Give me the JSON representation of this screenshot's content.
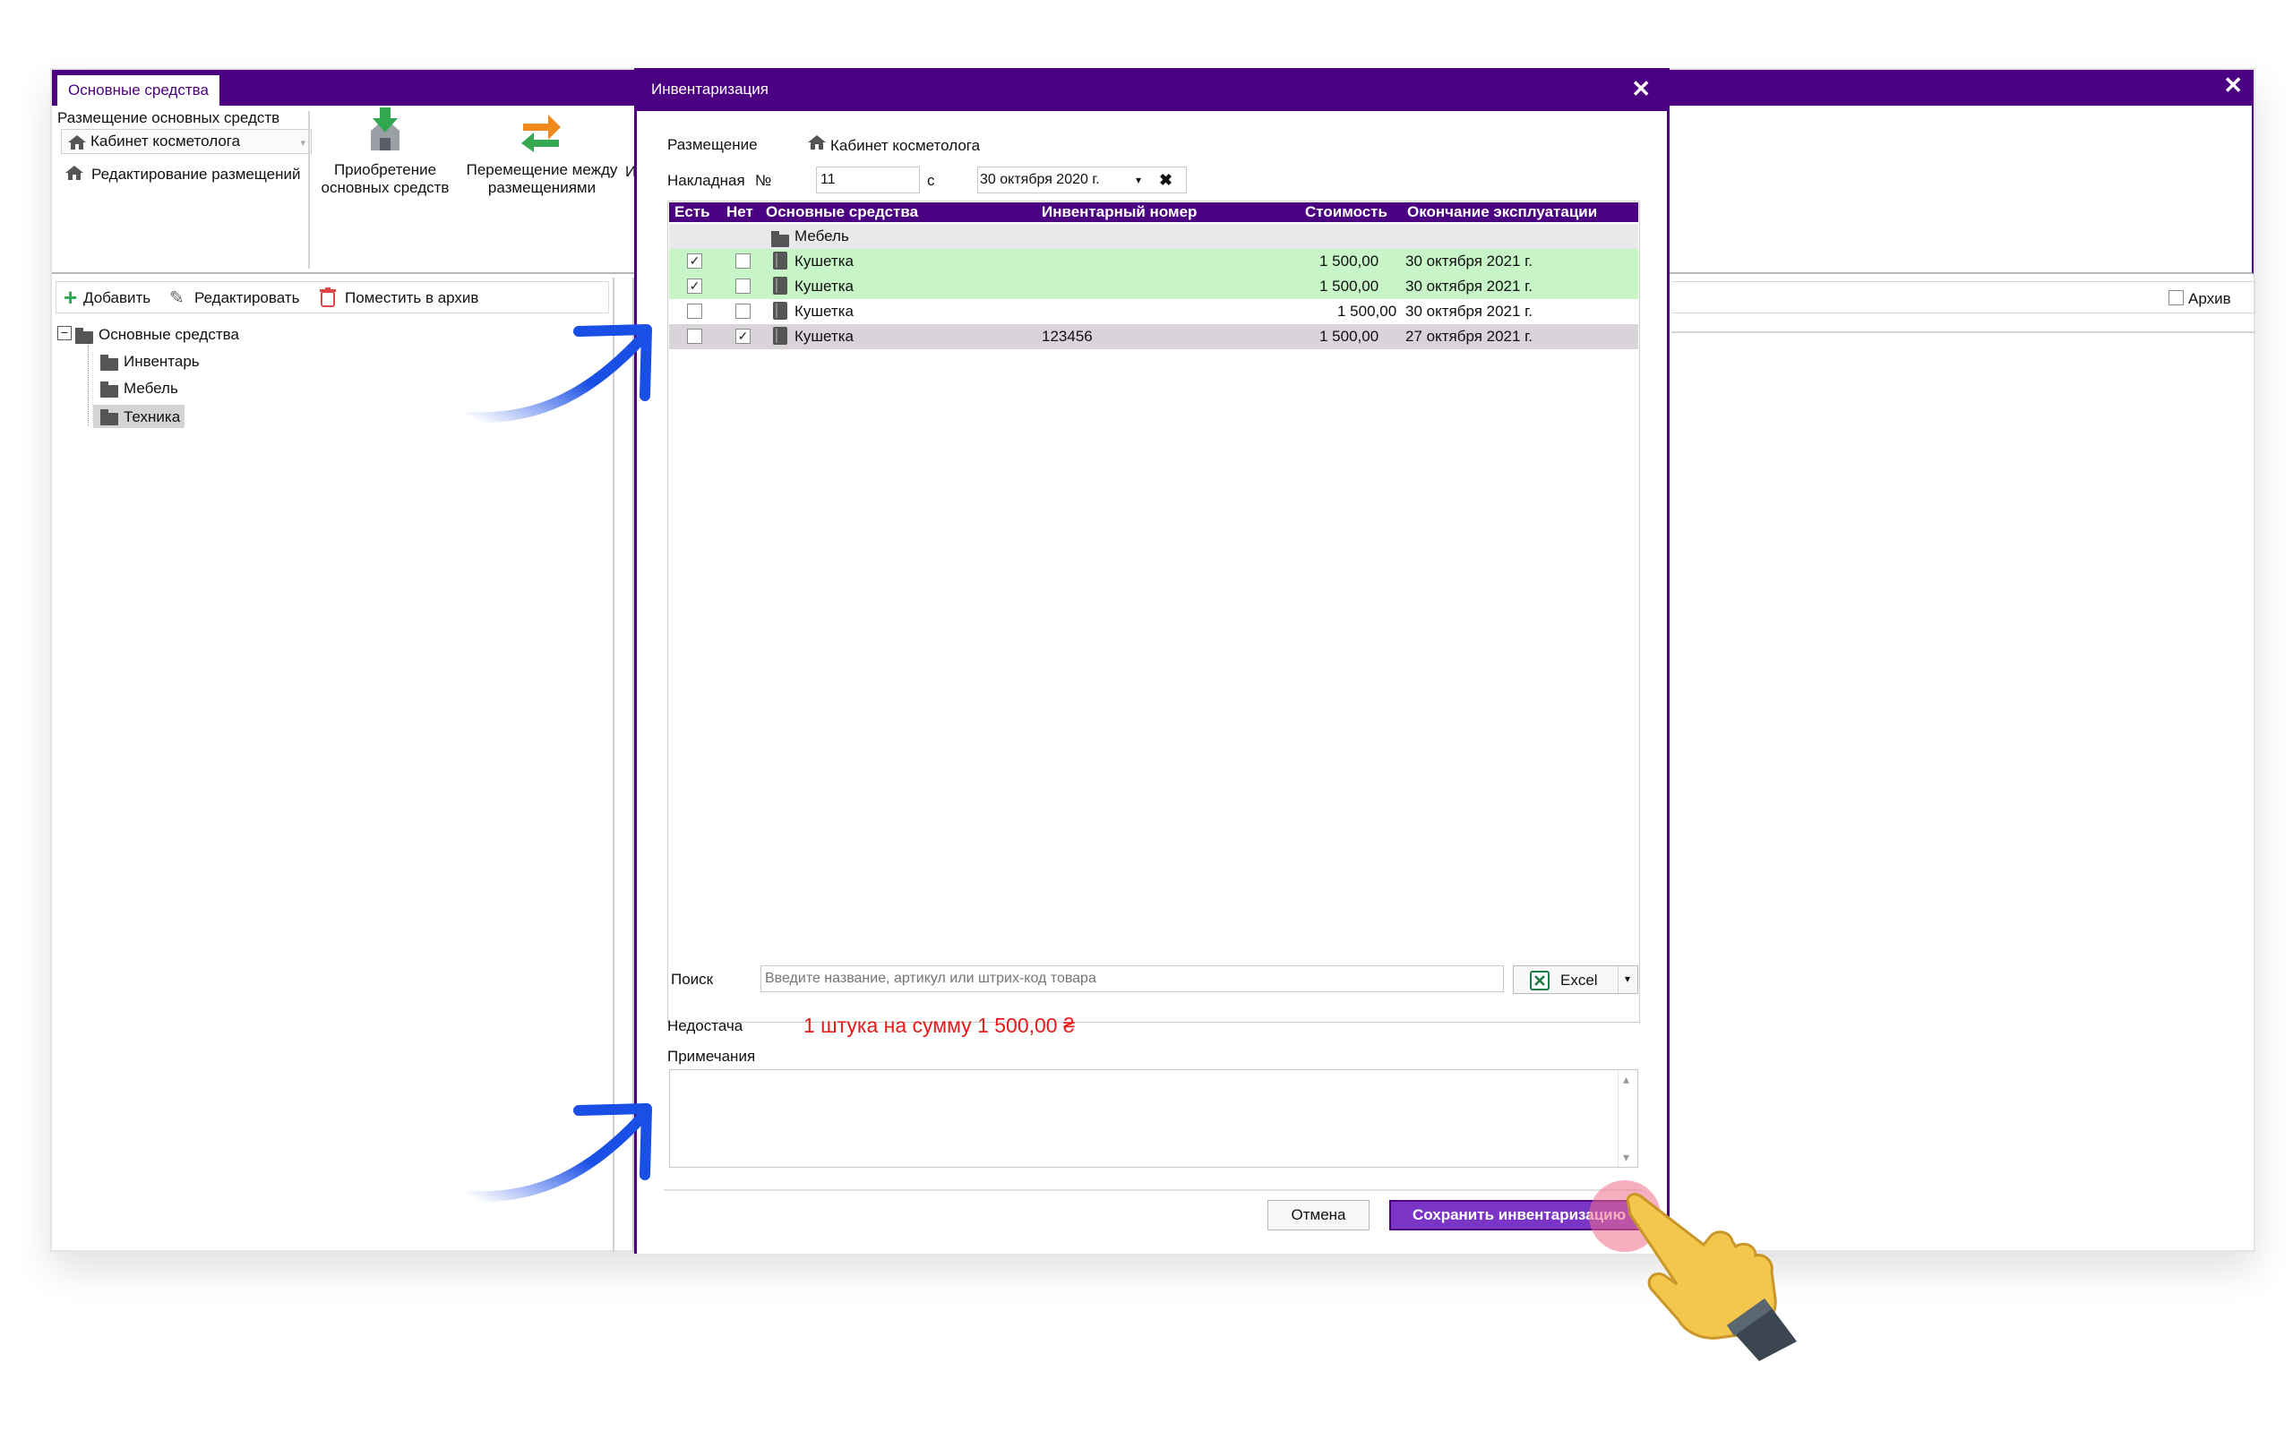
{
  "main_window": {
    "tab_label": "Основные средства",
    "close_glyph": "✕",
    "ribbon": {
      "placement_group_label": "Размещение основных средств",
      "placement_value": "Кабинет косметолога",
      "edit_placements_label": "Редактирование размещений",
      "acquisition_label_1": "Приобретение",
      "acquisition_label_2": "основных средств",
      "transfer_label_1": "Перемещение между",
      "transfer_label_2": "размещениями",
      "cut_label": "И"
    },
    "tree_toolbar": {
      "add_label": "Добавить",
      "edit_label": "Редактировать",
      "archive_label": "Поместить в архив"
    },
    "tree": {
      "root": "Основные средства",
      "children": [
        "Инвентарь",
        "Мебель",
        "Техника"
      ],
      "selected": "Техника"
    },
    "archive_checkbox_label": "Архив"
  },
  "dialog": {
    "title": "Инвентаризация",
    "close_glyph": "✕",
    "placement_label": "Размещение",
    "placement_value": "Кабинет косметолога",
    "invoice_label": "Накладная",
    "number_sign": "№",
    "invoice_number": "11",
    "from_label": "с",
    "date_value": "30 октября  2020 г.",
    "clear_glyph": "✖",
    "grid": {
      "columns": [
        "Есть",
        "Нет",
        "Основные средства",
        "Инвентарный номер",
        "Стоимость",
        "Окончание эксплуатации"
      ],
      "group": "Мебель",
      "rows": [
        {
          "present": true,
          "absent": false,
          "name": "Кушетка",
          "inventory_number": "",
          "cost": "1 500,00",
          "end_date": "30 октября 2021 г.",
          "status": "found"
        },
        {
          "present": true,
          "absent": false,
          "name": "Кушетка",
          "inventory_number": "",
          "cost": "1 500,00",
          "end_date": "30 октября 2021 г.",
          "status": "found"
        },
        {
          "present": false,
          "absent": false,
          "name": "Кушетка",
          "inventory_number": "",
          "cost": "1 500,00",
          "end_date": "30 октября 2021 г.",
          "status": "unchecked"
        },
        {
          "present": false,
          "absent": true,
          "name": "Кушетка",
          "inventory_number": "123456",
          "cost": "1 500,00",
          "end_date": "27 октября 2021 г.",
          "status": "missing"
        }
      ]
    },
    "search_label": "Поиск",
    "search_placeholder": "Введите название, артикул или штрих-код товара",
    "excel_label": "Excel",
    "shortage_label": "Недостача",
    "shortage_value": "1 штука на сумму 1 500,00 ₴",
    "notes_label": "Примечания",
    "notes_value": "",
    "cancel_label": "Отмена",
    "save_label": "Сохранить инвентаризацию"
  },
  "colors": {
    "brand": "#4b0082",
    "found_row": "#c7f5c7",
    "missing_row": "#d9d3da",
    "shortage_text": "#e81919",
    "save_button": "#7b35c6",
    "arrow": "#1a4fe6"
  }
}
